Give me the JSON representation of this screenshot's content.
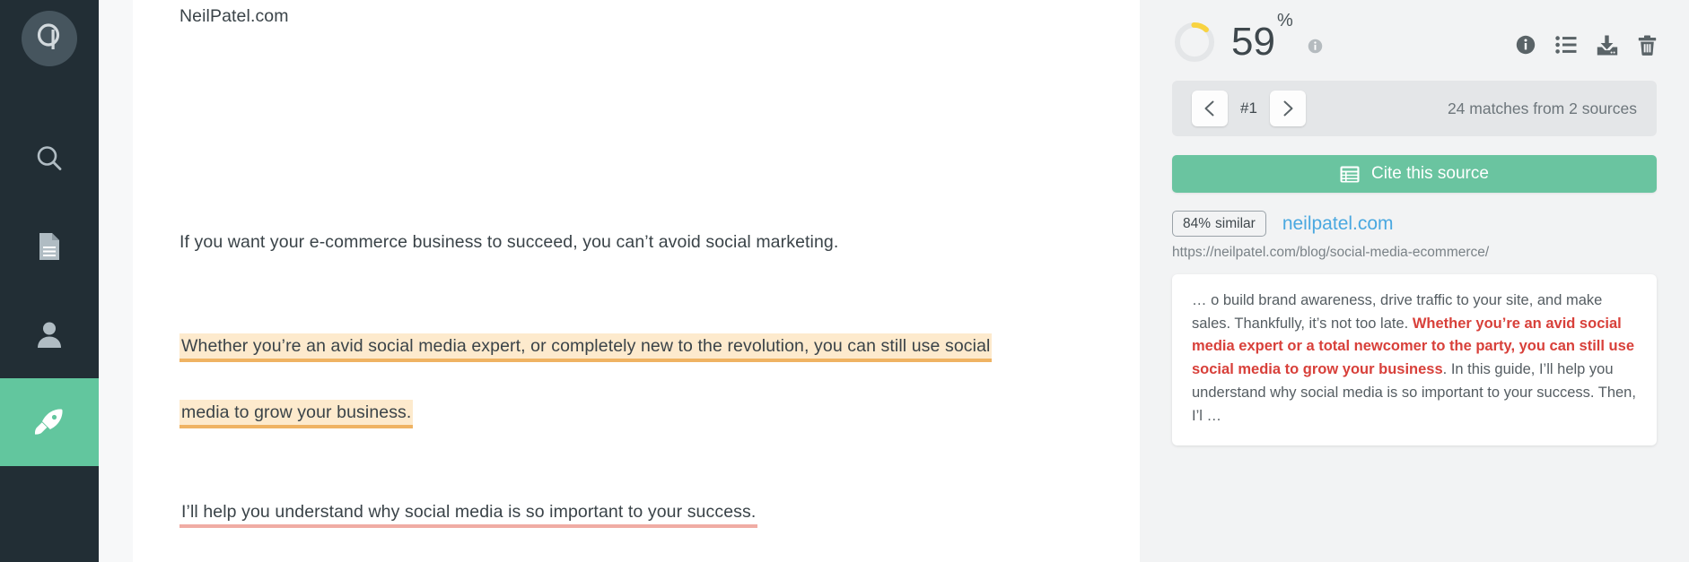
{
  "sidebar": {
    "logo": {
      "name": "quetext-logo",
      "letter": "q"
    },
    "items": [
      {
        "id": "search",
        "icon": "search-icon",
        "label": "Search",
        "active": false
      },
      {
        "id": "documents",
        "icon": "document-icon",
        "label": "Documents",
        "active": false
      },
      {
        "id": "account",
        "icon": "user-icon",
        "label": "Account",
        "active": false
      },
      {
        "id": "upgrade",
        "icon": "rocket-icon",
        "label": "Upgrade",
        "active": true
      }
    ],
    "active_color": "#62c69e",
    "background_color": "#222e35"
  },
  "document": {
    "source_title": "NeilPatel.com",
    "paragraphs": [
      {
        "id": "intro",
        "text": "If you want your e-commerce business to succeed, you can’t avoid social marketing.",
        "highlight": "none"
      },
      {
        "id": "match-line-1",
        "text": "Whether you’re an avid social media expert, or completely new to the revolution, you can still use social",
        "highlight": "orange"
      },
      {
        "id": "match-line-2",
        "text": "media to grow your business.",
        "highlight": "orange"
      },
      {
        "id": "match-line-3",
        "text": "I’ll help you understand why social media is so important to your success.",
        "highlight": "pink-underline"
      }
    ],
    "highlight_colors": {
      "orange_fill": "#fdeacd",
      "orange_underline": "#efb363",
      "pink_underline": "#f0aca4"
    }
  },
  "panel": {
    "score": {
      "value": "59",
      "percent_symbol": "%",
      "donut_fill_percent": 12,
      "donut_color": "#f8d341",
      "donut_track_color": "#e4e6e8",
      "info_icon": "info-circle-icon"
    },
    "tools": [
      {
        "id": "info",
        "icon": "info-circle-icon",
        "label": "Info"
      },
      {
        "id": "list",
        "icon": "list-icon",
        "label": "Matched sources list"
      },
      {
        "id": "download",
        "icon": "download-icon",
        "label": "Download report"
      },
      {
        "id": "delete",
        "icon": "trash-icon",
        "label": "Delete"
      }
    ],
    "navigation": {
      "prev_icon": "chevron-left-icon",
      "next_icon": "chevron-right-icon",
      "current_index": "#1",
      "matches_summary": "24 matches from 2 sources"
    },
    "cite_button": {
      "label": "Cite this source",
      "icon": "citation-card-icon",
      "color": "#6ac4a0"
    },
    "source": {
      "similarity_percent": "84%",
      "similarity_word": "similar",
      "domain": "neilpatel.com",
      "url": "https://neilpatel.com/blog/social-media-ecommerce/",
      "link_color": "#4aa8e0"
    },
    "excerpt": {
      "before": "… o build brand awareness, drive traffic to your site, and make sales. Thankfully, it’s not too late. ",
      "match": "Whether you’re an avid social media expert or a total newcomer to the party, you can still use social media to grow your business",
      "after": ". In this guide, I’ll help you understand why social media is so important to your success. Then, I’l …",
      "match_color": "#d8403a"
    }
  }
}
